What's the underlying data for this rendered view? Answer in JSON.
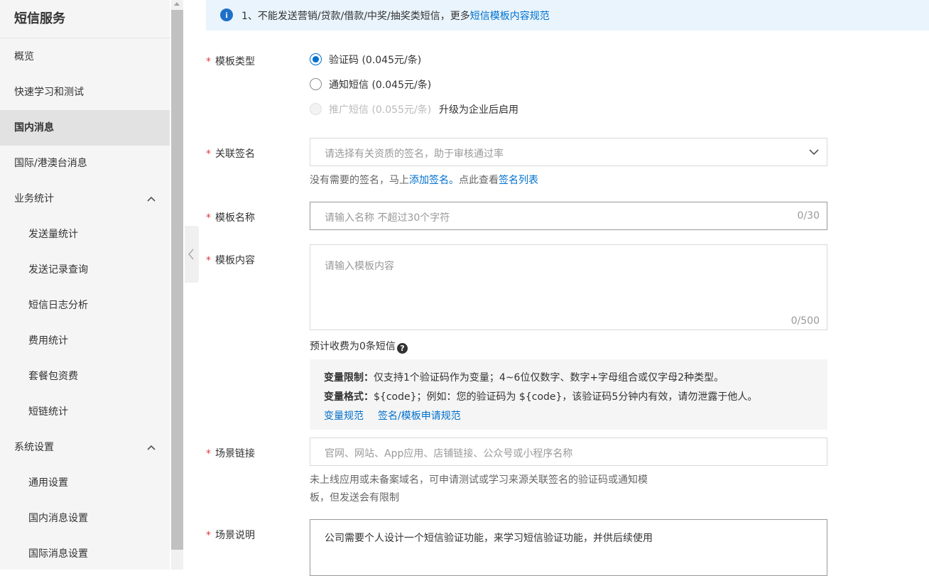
{
  "sidebar": {
    "title": "短信服务",
    "items": [
      {
        "label": "概览"
      },
      {
        "label": "快速学习和测试"
      },
      {
        "label": "国内消息"
      },
      {
        "label": "国际/港澳台消息"
      },
      {
        "label": "业务统计"
      },
      {
        "label": "发送量统计"
      },
      {
        "label": "发送记录查询"
      },
      {
        "label": "短信日志分析"
      },
      {
        "label": "费用统计"
      },
      {
        "label": "套餐包资费"
      },
      {
        "label": "短链统计"
      },
      {
        "label": "系统设置"
      },
      {
        "label": "通用设置"
      },
      {
        "label": "国内消息设置"
      },
      {
        "label": "国际消息设置"
      }
    ]
  },
  "notice": {
    "text": "1、不能发送营销/贷款/借款/中奖/抽奖类短信，更多",
    "link": "短信模板内容规范"
  },
  "form": {
    "template_type": {
      "label": "模板类型",
      "options": [
        {
          "label": "验证码 (0.045元/条)"
        },
        {
          "label": "通知短信 (0.045元/条)"
        },
        {
          "label": "推广短信 (0.055元/条)",
          "note": "升级为企业后启用"
        }
      ]
    },
    "signature": {
      "label": "关联签名",
      "placeholder": "请选择有关资质的签名，助于审核通过率",
      "help_prefix": "没有需要的签名，马上",
      "help_link1": "添加签名。",
      "help_middle": "点此查看",
      "help_link2": "签名列表"
    },
    "template_name": {
      "label": "模板名称",
      "placeholder": "请输入名称 不超过30个字符",
      "counter": "0/30"
    },
    "template_content": {
      "label": "模板内容",
      "placeholder": "请输入模板内容",
      "counter": "0/500",
      "estimate": "预计收费为0条短信"
    },
    "rules": {
      "limit_label": "变量限制：",
      "limit_text": "仅支持1个验证码作为变量；4~6位仅数字、数字+字母组合或仅字母2种类型。",
      "format_label": "变量格式：",
      "format_text": "${code}；例如：您的验证码为 ${code}，该验证码5分钟内有效，请勿泄露于他人。",
      "link1": "变量规范",
      "link2": "签名/模板申请规范"
    },
    "scene_link": {
      "label": "场景链接",
      "placeholder": "官网、网站、App应用、店铺链接、公众号或小程序名称",
      "help_line1": "未上线应用或未备案域名，可申请测试或学习来源关联签名的验证码或通知模",
      "help_line2": "板，但发送会有限制"
    },
    "scene_desc": {
      "label": "场景说明",
      "value": "公司需要个人设计一个短信验证功能，来学习短信验证功能，并供后续使用"
    }
  },
  "colors": {
    "link": "#0070cc",
    "required": "#e4393c",
    "notice_bg": "#e9f4fd",
    "sidebar_bg": "#f5f5f5"
  }
}
